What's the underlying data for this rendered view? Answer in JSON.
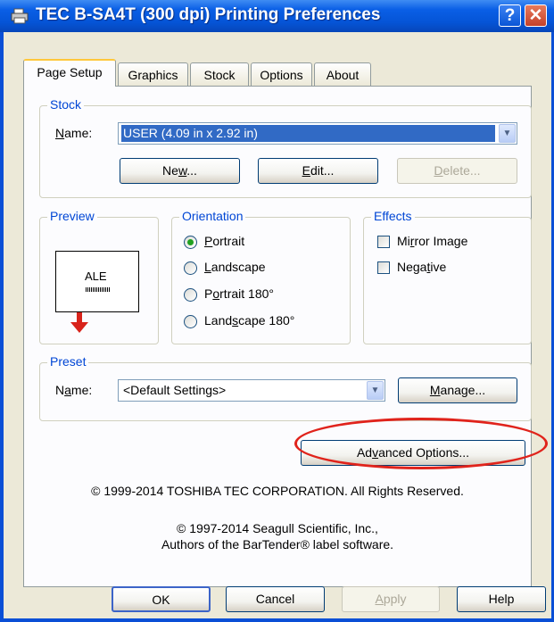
{
  "window": {
    "title": "TEC B-SA4T (300 dpi) Printing Preferences",
    "help_btn": "?",
    "close_btn": "✕"
  },
  "tabs": [
    {
      "label": "Page Setup",
      "active": true
    },
    {
      "label": "Graphics"
    },
    {
      "label": "Stock"
    },
    {
      "label": "Options"
    },
    {
      "label": "About"
    }
  ],
  "stock": {
    "legend": "Stock",
    "name_label_pre": "",
    "name_label_u": "N",
    "name_label_post": "ame:",
    "name_value": "USER (4.09 in x 2.92 in)",
    "new_pre": "Ne",
    "new_u": "w",
    "new_post": "...",
    "edit_pre": "",
    "edit_u": "E",
    "edit_post": "dit...",
    "delete_pre": "",
    "delete_u": "D",
    "delete_post": "elete..."
  },
  "preview": {
    "legend": "Preview",
    "label_text": "ALE"
  },
  "orientation": {
    "legend": "Orientation",
    "options": [
      {
        "pre": "",
        "u": "P",
        "post": "ortrait",
        "selected": true
      },
      {
        "pre": "",
        "u": "L",
        "post": "andscape",
        "selected": false
      },
      {
        "pre": "P",
        "u": "o",
        "post": "rtrait 180°",
        "selected": false
      },
      {
        "pre": "Land",
        "u": "s",
        "post": "cape 180°",
        "selected": false
      }
    ]
  },
  "effects": {
    "legend": "Effects",
    "mirror_pre": "Mi",
    "mirror_u": "r",
    "mirror_post": "ror Image",
    "negative_pre": "Nega",
    "negative_u": "t",
    "negative_post": "ive"
  },
  "preset": {
    "legend": "Preset",
    "name_pre": "N",
    "name_u": "a",
    "name_post": "me:",
    "value": "<Default Settings>",
    "manage_pre": "",
    "manage_u": "M",
    "manage_post": "anage..."
  },
  "advanced": {
    "pre": "Ad",
    "u": "v",
    "post": "anced Options..."
  },
  "copyright1": "© 1999-2014 TOSHIBA TEC CORPORATION.  All Rights Reserved.",
  "copyright2": "© 1997-2014 Seagull Scientific, Inc.,",
  "copyright3": "Authors of the BarTender® label software.",
  "footer": {
    "ok": "OK",
    "cancel": "Cancel",
    "apply_pre": "",
    "apply_u": "A",
    "apply_post": "pply",
    "help": "Help"
  },
  "colors": {
    "titlebar": "#0554d6",
    "highlight": "#316ac5",
    "annotation": "#e0231b",
    "legend": "#0046d5"
  }
}
